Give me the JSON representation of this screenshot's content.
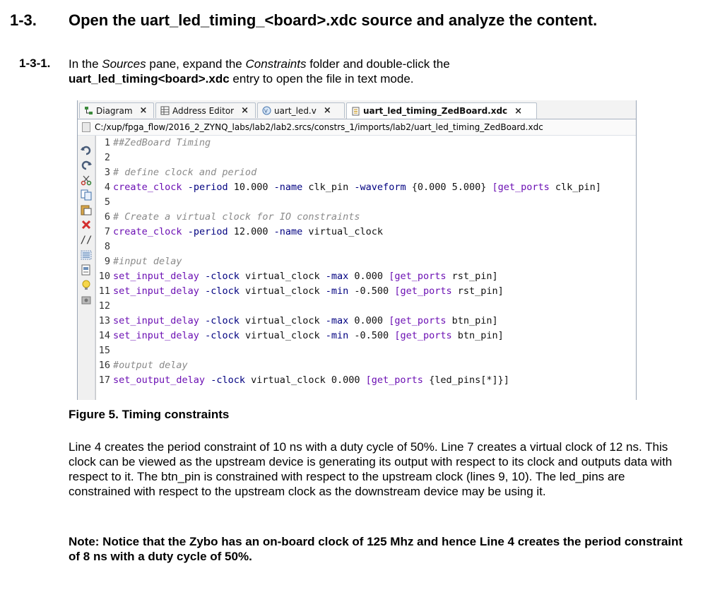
{
  "section": {
    "number": "1-3.",
    "title": "Open the uart_led_timing_<board>.xdc source and analyze the content."
  },
  "step": {
    "number": "1-3-1.",
    "line1_a": "In the ",
    "line1_sources": "Sources",
    "line1_b": " pane, expand the ",
    "line1_constraints": "Constraints",
    "line1_c": " folder and double-click the",
    "line2_file": "uart_led_timing<board>.xdc",
    "line2_rest": " entry to open the file in text mode."
  },
  "editor": {
    "tabs": [
      {
        "label": "Diagram",
        "icon": "diagram-icon",
        "active": false
      },
      {
        "label": "Address Editor",
        "icon": "address-editor-icon",
        "active": false
      },
      {
        "label": "uart_led.v",
        "icon": "verilog-file-icon",
        "active": false
      },
      {
        "label": "uart_led_timing_ZedBoard.xdc",
        "icon": "xdc-file-icon",
        "active": true
      }
    ],
    "path": "C:/xup/fpga_flow/2016_2_ZYNQ_labs/lab2/lab2.srcs/constrs_1/imports/lab2/uart_led_timing_ZedBoard.xdc",
    "tools": [
      "undo-icon",
      "redo-icon",
      "cut-icon",
      "copy-icon",
      "paste-icon",
      "delete-icon",
      "comment-icon",
      "block-select-icon",
      "insert-template-icon",
      "hint-icon",
      "settings-icon"
    ],
    "lines": [
      {
        "n": "1",
        "text": "##ZedBoard Timing"
      },
      {
        "n": "2",
        "text": ""
      },
      {
        "n": "3",
        "text": "# define clock and period"
      },
      {
        "n": "4",
        "text": "create_clock -period 10.000 -name clk_pin -waveform {0.000 5.000} [get_ports clk_pin]"
      },
      {
        "n": "5",
        "text": ""
      },
      {
        "n": "6",
        "text": "# Create a virtual clock for IO constraints"
      },
      {
        "n": "7",
        "text": "create_clock -period 12.000 -name virtual_clock"
      },
      {
        "n": "8",
        "text": ""
      },
      {
        "n": "9",
        "text": "#input delay"
      },
      {
        "n": "10",
        "text": "set_input_delay -clock virtual_clock -max 0.000 [get_ports rst_pin]"
      },
      {
        "n": "11",
        "text": "set_input_delay -clock virtual_clock -min -0.500 [get_ports rst_pin]"
      },
      {
        "n": "12",
        "text": ""
      },
      {
        "n": "13",
        "text": "set_input_delay -clock virtual_clock -max 0.000 [get_ports btn_pin]"
      },
      {
        "n": "14",
        "text": "set_input_delay -clock virtual_clock -min -0.500 [get_ports btn_pin]"
      },
      {
        "n": "15",
        "text": ""
      },
      {
        "n": "16",
        "text": "#output delay"
      },
      {
        "n": "17",
        "text": "set_output_delay -clock virtual_clock 0.000 [get_ports {led_pins[*]}]"
      }
    ]
  },
  "figure_caption": "Figure 5. Timing constraints",
  "paragraph": "Line 4 creates the period constraint of 10 ns with a duty cycle of 50%. Line 7 creates a virtual clock of 12 ns. This clock can be viewed as the upstream device is generating its output with respect to its clock and outputs data with respect to it. The btn_pin is constrained with respect to the upstream clock (lines 9, 10).  The led_pins are constrained with respect to the upstream clock as the downstream device may be using it.",
  "note": "Note: Notice that the Zybo has an on-board clock of 125 Mhz and hence Line 4 creates the period constraint of 8 ns with a duty cycle of 50%."
}
